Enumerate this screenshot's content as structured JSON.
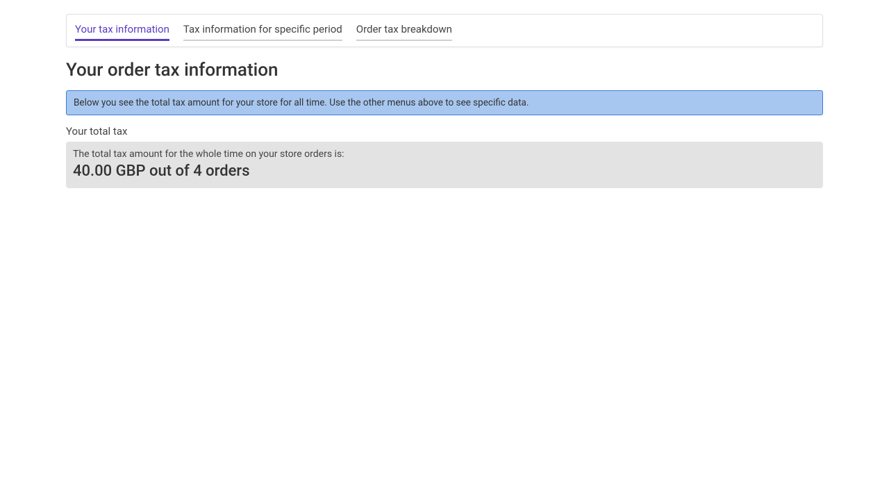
{
  "tabs": {
    "items": [
      {
        "label": "Your tax information",
        "active": true
      },
      {
        "label": "Tax information for specific period",
        "active": false
      },
      {
        "label": "Order tax breakdown",
        "active": false
      }
    ]
  },
  "page": {
    "title": "Your order tax information"
  },
  "banner": {
    "text": "Below you see the total tax amount for your store for all time. Use the other menus above to see specific data."
  },
  "section": {
    "label": "Your total tax",
    "description": "The total tax amount for the whole time on your store orders is:",
    "value": "40.00 GBP out of 4 orders"
  }
}
